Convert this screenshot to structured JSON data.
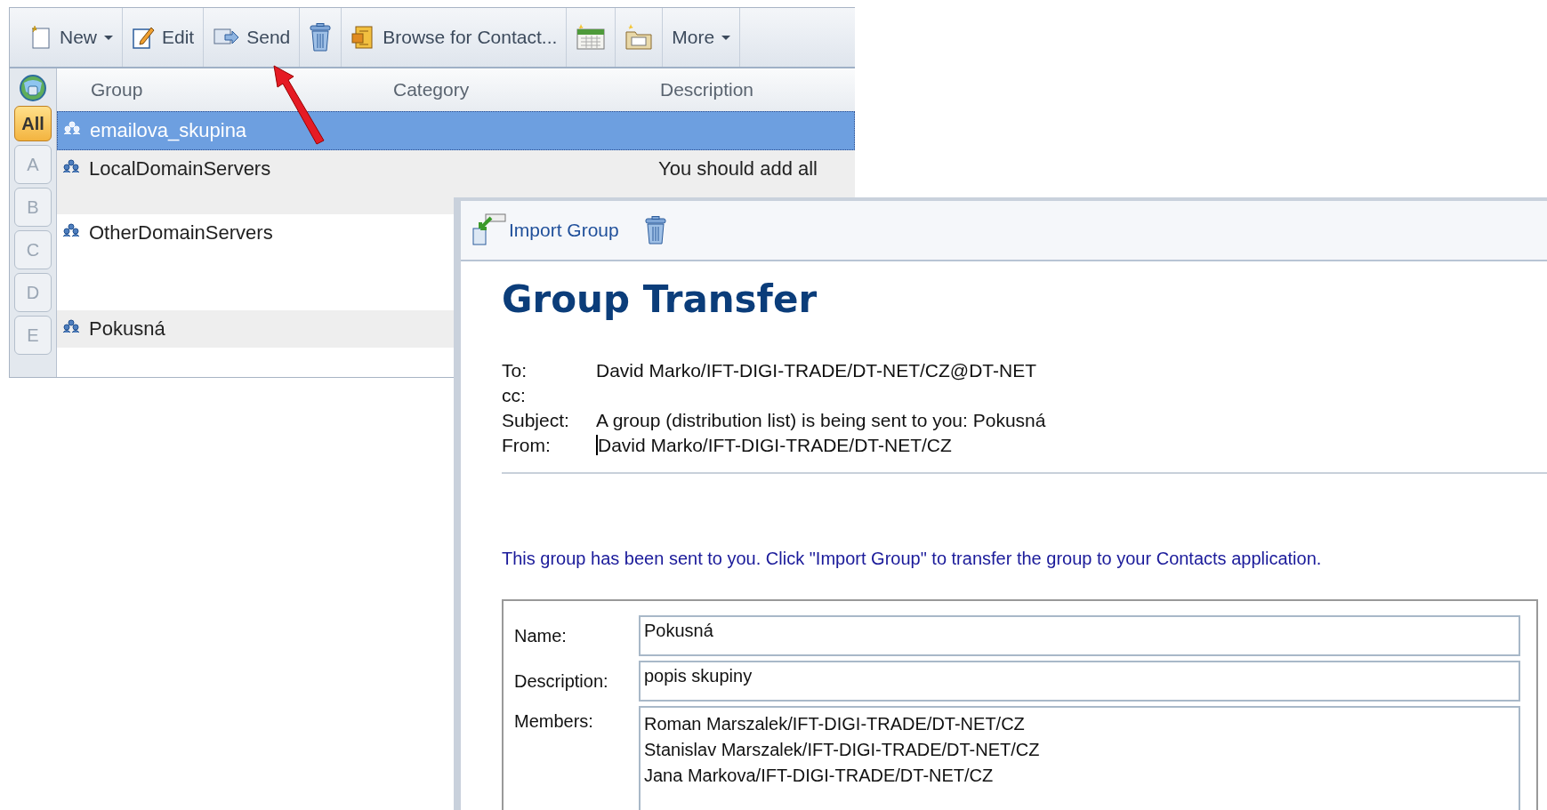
{
  "contacts_window": {
    "toolbar": [
      {
        "kind": "menu",
        "label": "New"
      },
      {
        "kind": "button",
        "label": "Edit"
      },
      {
        "kind": "button",
        "label": "Send"
      },
      {
        "kind": "icon"
      },
      {
        "kind": "button",
        "label": "Browse for Contact..."
      },
      {
        "kind": "icon"
      },
      {
        "kind": "icon"
      },
      {
        "kind": "menu",
        "label": "More"
      }
    ],
    "columns": [
      "Group",
      "Category",
      "Description"
    ],
    "alphabet": [
      {
        "label": "All",
        "selected": true
      },
      {
        "label": "A",
        "selected": false
      },
      {
        "label": "B",
        "selected": false
      },
      {
        "label": "C",
        "selected": false
      },
      {
        "label": "D",
        "selected": false
      },
      {
        "label": "E",
        "selected": false
      }
    ],
    "rows": [
      {
        "group": "emailova_skupina",
        "selected": true
      },
      {
        "group": "LocalDomainServers",
        "description": "You should add all",
        "selected": false
      },
      {
        "group": "OtherDomainServers",
        "selected": false
      },
      {
        "group": "Pokusná",
        "selected": false
      }
    ]
  },
  "transfer_window": {
    "actions": [
      {
        "kind": "import",
        "label": "Import Group"
      },
      {
        "kind": "trash"
      }
    ],
    "title": "Group Transfer",
    "headers": [
      {
        "label": "To:",
        "value": "David Marko/IFT-DIGI-TRADE/DT-NET/CZ@DT-NET",
        "cursor": false
      },
      {
        "label": "cc:"
      },
      {
        "label": "Subject:",
        "value": "A group (distribution list) is being sent to you:  Pokusná",
        "cursor": false
      },
      {
        "label": "From:",
        "value": "David Marko/IFT-DIGI-TRADE/DT-NET/CZ",
        "cursor": true
      }
    ],
    "note": "This group has been sent to you.  Click \"Import Group\" to transfer the group to your Contacts application.",
    "form": {
      "name_label": "Name:",
      "name": "Pokusná",
      "description_label": "Description:",
      "description": "popis skupiny",
      "members_label": "Members:",
      "members": [
        "Roman Marszalek/IFT-DIGI-TRADE/DT-NET/CZ",
        "Stanislav Marszalek/IFT-DIGI-TRADE/DT-NET/CZ",
        "Jana Markova/IFT-DIGI-TRADE/DT-NET/CZ"
      ]
    }
  }
}
